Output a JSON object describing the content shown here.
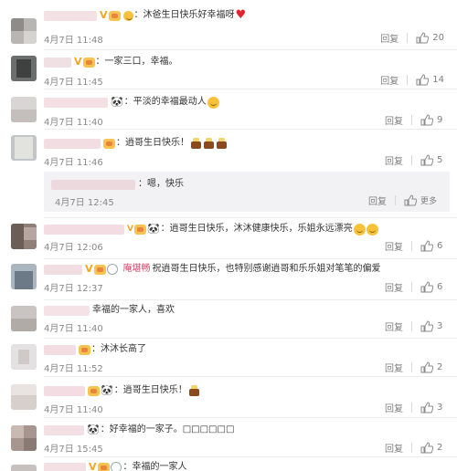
{
  "ui": {
    "reply_label": "回复",
    "more_label": "更多"
  },
  "comments": [
    {
      "time": "4月7日 11:48",
      "text": "：沐爸生日快乐",
      "tail": "好幸福呀",
      "likes": "20"
    },
    {
      "time": "4月7日 11:45",
      "text": "：一家三口",
      "tail": "，幸福。",
      "likes": "14"
    },
    {
      "time": "4月7日 11:40",
      "text": "：平淡的幸福最动人",
      "likes": "9"
    },
    {
      "time": "4月7日 11:46",
      "text": "：逍哥生日快乐！",
      "likes": "5",
      "reply": {
        "time": "4月7日 12:45",
        "text": "：嗯，快乐"
      }
    },
    {
      "time": "4月7日 12:06",
      "text": "：逍哥生日快乐，沐沐健康快乐，乐姐永远漂亮",
      "likes": "6"
    },
    {
      "time": "4月7日 12:37",
      "vote": "庵堪畅",
      "text": "祝逍哥生日快乐，也特别感谢逍哥和乐乐姐对笔笔的偏爱",
      "likes": "6"
    },
    {
      "time": "4月7日 11:40",
      "text": "幸福的一家人，喜欢",
      "likes": "3"
    },
    {
      "time": "4月7日 11:52",
      "text": "：沐沐长高了",
      "likes": "2"
    },
    {
      "time": "4月7日 11:40",
      "text": "：逍哥生日快乐！",
      "likes": "3"
    },
    {
      "time": "4月7日 15:45",
      "text": "：好幸福的一家子。",
      "tail": "□□□□□□",
      "likes": "2"
    },
    {
      "time": "",
      "text": "：幸福的一家人",
      "likes": ""
    }
  ]
}
